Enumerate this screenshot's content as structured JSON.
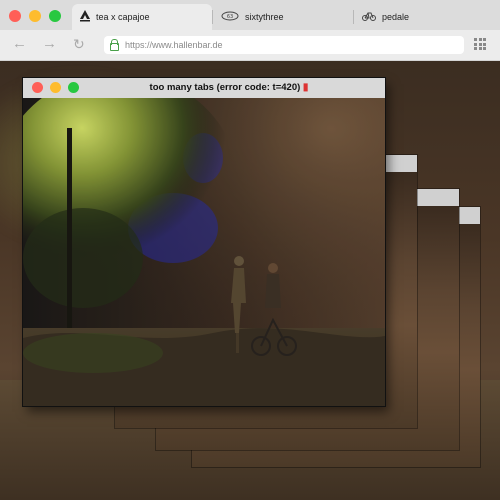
{
  "window_controls": {
    "close_color": "#ff5f57",
    "minimize_color": "#febc2e",
    "zoom_color": "#28c840"
  },
  "tabs": [
    {
      "label": "tea x capajoe",
      "icon": "capajoe-logo-icon",
      "active": true
    },
    {
      "label": "sixtythree",
      "icon": "sixtythree-logo-icon",
      "active": false
    },
    {
      "label": "pedale",
      "icon": "bicycle-icon",
      "active": false
    }
  ],
  "url": {
    "text": "https://www.hallenbar.de"
  },
  "main_window": {
    "title": "too many tabs (error code: t=420)",
    "title_icon": "bottle-icon"
  }
}
